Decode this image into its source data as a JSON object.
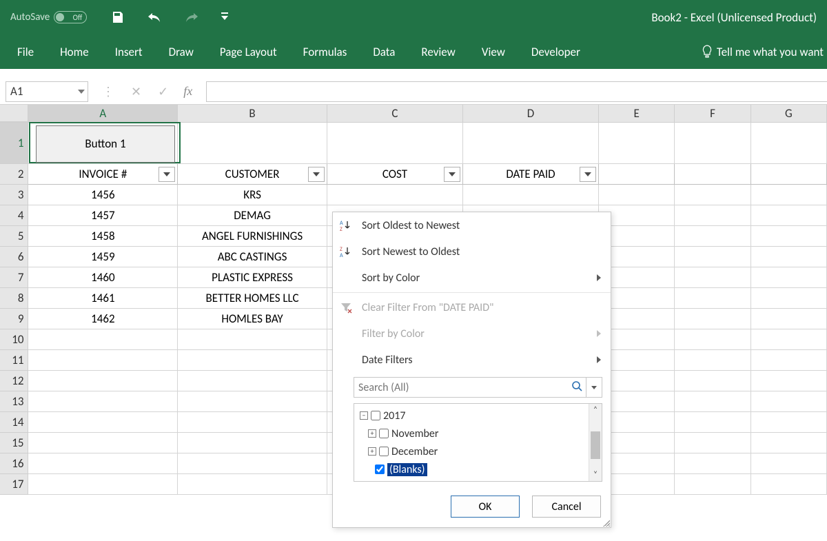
{
  "titlebar": {
    "autosave_label": "AutoSave",
    "autosave_state": "Off",
    "title": "Book2  -  Excel (Unlicensed Product)"
  },
  "ribbon": {
    "tabs": [
      "File",
      "Home",
      "Insert",
      "Draw",
      "Page Layout",
      "Formulas",
      "Data",
      "Review",
      "View",
      "Developer"
    ],
    "tellme": "Tell me what you want"
  },
  "formula": {
    "namebox": "A1",
    "fx_label": "fx",
    "value": ""
  },
  "columns": [
    "A",
    "B",
    "C",
    "D",
    "E",
    "F",
    "G"
  ],
  "active_cell": "A1",
  "button_shape": {
    "label": "Button 1"
  },
  "headers": {
    "invoice": "INVOICE #",
    "customer": "CUSTOMER",
    "cost": "COST",
    "date_paid": "DATE PAID"
  },
  "rows": [
    {
      "invoice": "1456",
      "customer": "KRS"
    },
    {
      "invoice": "1457",
      "customer": "DEMAG"
    },
    {
      "invoice": "1458",
      "customer": "ANGEL FURNISHINGS"
    },
    {
      "invoice": "1459",
      "customer": "ABC CASTINGS"
    },
    {
      "invoice": "1460",
      "customer": "PLASTIC EXPRESS"
    },
    {
      "invoice": "1461",
      "customer": "BETTER HOMES LLC"
    },
    {
      "invoice": "1462",
      "customer": "HOMLES BAY"
    }
  ],
  "filter_menu": {
    "sort_asc": "Sort Oldest to Newest",
    "sort_desc": "Sort Newest to Oldest",
    "sort_by_color": "Sort by Color",
    "clear_filter": "Clear Filter From \"DATE PAID\"",
    "filter_by_color": "Filter by Color",
    "date_filters": "Date Filters",
    "search_placeholder": "Search (All)",
    "tree": {
      "year": "2017",
      "months": [
        "November",
        "December"
      ],
      "blanks": "(Blanks)"
    },
    "ok": "OK",
    "cancel": "Cancel"
  }
}
